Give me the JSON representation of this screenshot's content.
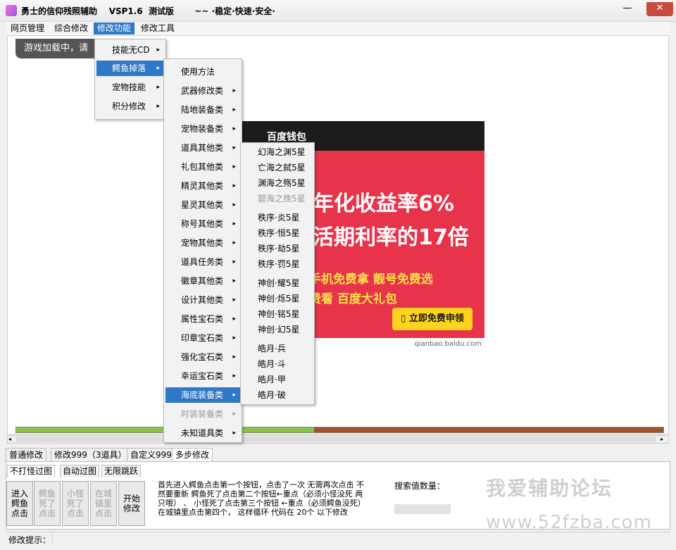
{
  "window": {
    "title": "勇士的信仰残照辅助    VSP1.6  测试版       ~~ ·稳定·快速·安全·",
    "min_label": "—",
    "max_label": "☐",
    "close_label": "✕"
  },
  "menubar": [
    "网页管理",
    "综合修改",
    "修改功能",
    "修改工具"
  ],
  "toast": "游戏加载中，请",
  "menu_level1": [
    {
      "label": "技能无CD",
      "arrow": "▸"
    },
    {
      "label": "鳄鱼掉落",
      "arrow": "▸"
    },
    {
      "label": "宠物技能",
      "arrow": "▸"
    },
    {
      "label": "积分修改",
      "arrow": "▸"
    }
  ],
  "menu_level2": [
    {
      "label": "使用方法",
      "arrow": ""
    },
    {
      "label": "武器修改类",
      "arrow": "▸"
    },
    {
      "label": "陆地装备类",
      "arrow": "▸"
    },
    {
      "label": "宠物装备类",
      "arrow": "▸"
    },
    {
      "label": "道具其他类",
      "arrow": "▸"
    },
    {
      "label": "礼包其他类",
      "arrow": "▸"
    },
    {
      "label": "精灵其他类",
      "arrow": "▸"
    },
    {
      "label": "星灵其他类",
      "arrow": "▸"
    },
    {
      "label": "称号其他类",
      "arrow": "▸"
    },
    {
      "label": "宠物其他类",
      "arrow": "▸"
    },
    {
      "label": "道具任务类",
      "arrow": "▸"
    },
    {
      "label": "徽章其他类",
      "arrow": "▸"
    },
    {
      "label": "设计其他类",
      "arrow": "▸"
    },
    {
      "label": "属性宝石类",
      "arrow": "▸"
    },
    {
      "label": "印章宝石类",
      "arrow": "▸"
    },
    {
      "label": "强化宝石类",
      "arrow": "▸"
    },
    {
      "label": "幸运宝石类",
      "arrow": "▸"
    },
    {
      "label": "海底装备类",
      "arrow": "▸"
    },
    {
      "label": "时装装备类",
      "arrow": "▸"
    },
    {
      "label": "未知道具类",
      "arrow": "▸"
    }
  ],
  "menu_level3": [
    "幻海之渊5星",
    "亡海之弑5星",
    "渊海之殇5星",
    "碧海之挽5星",
    "秩序·炎5星",
    "秩序·恒5星",
    "秩序·劫5星",
    "秩序·罚5星",
    "神创·耀5星",
    "神创·烁5星",
    "神创·铭5星",
    "神创·幻5星",
    "皓月·兵",
    "皓月·斗",
    "皓月·甲",
    "皓月·破"
  ],
  "ad": {
    "brand": "百度钱包",
    "line1": "年化收益率6%",
    "line2": "活期利率的17倍",
    "line3": "手机免费拿  靓号免费选",
    "line4": "费看  百度大礼包",
    "cta": "▯ 立即免费申领",
    "footer": "qianbao.baidu.com",
    "bg_color": "#e8344b",
    "accent_color": "#ffd21f"
  },
  "progress": {
    "fraction": 0.46,
    "fill_color": "#8bc34a",
    "track_color": "#a0522d"
  },
  "tabs_main": [
    "普通修改",
    "修改999（3道具）",
    "自定义999",
    "多步修改"
  ],
  "tabs_sub": [
    "不打怪过图",
    "自动过图",
    "无限跳跃"
  ],
  "buttons": [
    {
      "label": "进入鳄鱼点击",
      "disabled": false
    },
    {
      "label": "鳄鱼死了点击",
      "disabled": true
    },
    {
      "label": "小怪死了点击",
      "disabled": true
    },
    {
      "label": "在城镇里点击",
      "disabled": true
    },
    {
      "label": "开始修改",
      "disabled": false
    }
  ],
  "instructions": "首先进入鳄鱼点击第一个按钮，点击了一次 无需再次点击 不然要重新  鳄鱼死了点击第二个按钮←重点（必须小怪没死 两只哦） 、 小怪死了点击第三个按钮  ←重点（必须鳄鱼没死）  在城镇里点击第四个，    这样循环 代码在 20个 以下修改",
  "search_label": "搜索值数量：",
  "watermark": "我爱辅助论坛",
  "watermark_url": "www.52fzba.com",
  "status_label": "修改提示："
}
